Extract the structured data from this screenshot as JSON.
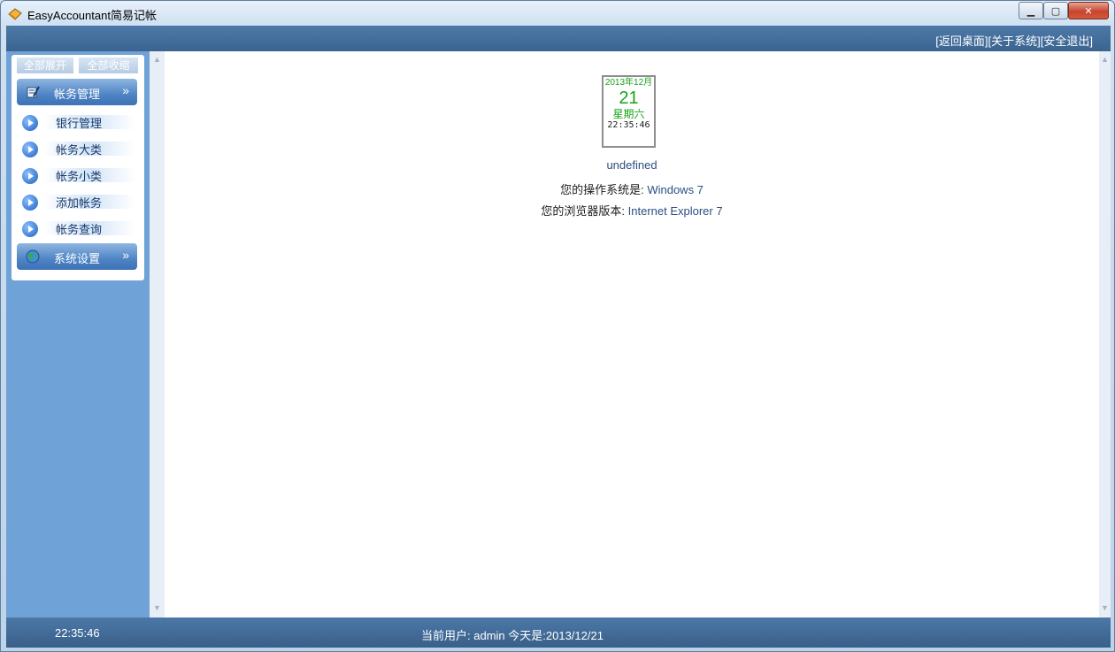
{
  "window": {
    "title": "EasyAccountant简易记帐"
  },
  "toplinks": {
    "desktop": "[返回桌面]",
    "about": "[关于系统]",
    "logout": "[安全退出]"
  },
  "sidebar": {
    "expand_all": "全部展开",
    "collapse_all": "全部收缩",
    "groups": [
      {
        "label": "帐务管理",
        "icon": "book-pen-icon",
        "chevron": "»"
      },
      {
        "label": "系统设置",
        "icon": "globe-icon",
        "chevron": "»"
      }
    ],
    "items": [
      "银行管理",
      "帐务大类",
      "帐务小类",
      "添加帐务",
      "帐务查询"
    ]
  },
  "calendar": {
    "year_month": "2013年12月",
    "day": "21",
    "weekday": "星期六",
    "time": "22:35:46"
  },
  "info": {
    "line1": "undefined",
    "os_label": "您的操作系统是: ",
    "os_value": "Windows 7",
    "browser_label": "您的浏览器版本: ",
    "browser_value": "Internet Explorer 7"
  },
  "status": {
    "time": "22:35:46",
    "user_label": "当前用户: ",
    "user": "admin",
    "today_label": "  今天是:",
    "date": "2013/12/21"
  },
  "colors": {
    "header_bar": "#3b648f",
    "sidebar": "#6fa2d6",
    "calendar_text": "#18a318"
  }
}
